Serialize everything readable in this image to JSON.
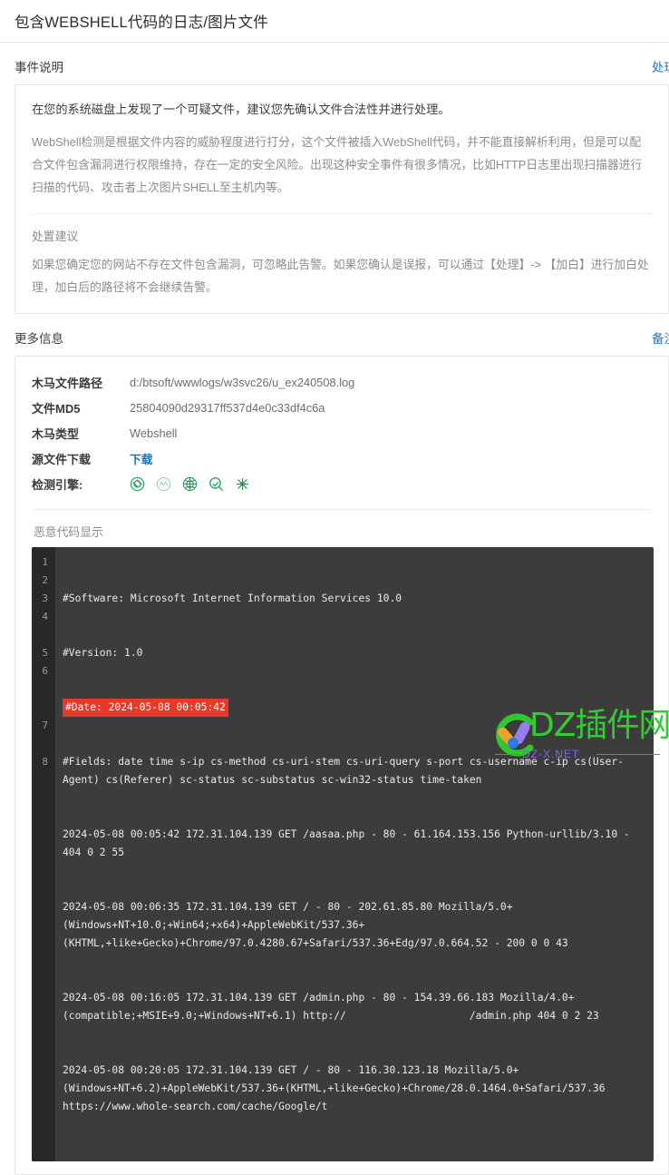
{
  "header": {
    "title": "包含WEBSHELL代码的日志/图片文件"
  },
  "event_section": {
    "title": "事件说明",
    "action_label": "处理",
    "lead": "在您的系统磁盘上发现了一个可疑文件，建议您先确认文件合法性并进行处理。",
    "body": "WebShell检测是根据文件内容的威胁程度进行打分，这个文件被插入WebShell代码，并不能直接解析利用，但是可以配合文件包含漏洞进行权限维持，存在一定的安全风险。出现这种安全事件有很多情况，比如HTTP日志里出现扫描器进行扫描的代码、攻击者上次图片SHELL至主机内等。",
    "advice_title": "处置建议",
    "advice_body": "如果您确定您的网站不存在文件包含漏洞，可忽略此告警。如果您确认是误报，可以通过【处理】-> 【加白】进行加白处理，加白后的路径将不会继续告警。"
  },
  "more_info_section": {
    "title": "更多信息",
    "action_label": "备注",
    "rows": [
      {
        "label": "木马文件路径",
        "value": "d:/btsoft/wwwlogs/w3svc26/u_ex240508.log",
        "type": "text"
      },
      {
        "label": "文件MD5",
        "value": "25804090d29317ff537d4e0c33df4c6a",
        "type": "text"
      },
      {
        "label": "木马类型",
        "value": "Webshell",
        "type": "text"
      },
      {
        "label": "源文件下载",
        "value": "下载",
        "type": "link"
      },
      {
        "label": "检测引擎:",
        "value": "",
        "type": "engines"
      }
    ],
    "engines": [
      "engine-swirl-icon",
      "engine-wave-icon",
      "engine-globe-icon",
      "engine-magnifier-icon",
      "engine-molecule-icon"
    ],
    "engine_color": "#1f9c5a"
  },
  "code_section": {
    "title": "恶意代码显示",
    "highlight_color": "#e8382a",
    "lines": [
      {
        "num": "1",
        "text": "#Software: Microsoft Internet Information Services 10.0",
        "highlight": false
      },
      {
        "num": "2",
        "text": "#Version: 1.0",
        "highlight": false
      },
      {
        "num": "3",
        "text": "#Date: 2024-05-08 00:05:42",
        "highlight": true
      },
      {
        "num": "4",
        "text": "#Fields: date time s-ip cs-method cs-uri-stem cs-uri-query s-port cs-username c-ip cs(User-Agent) cs(Referer) sc-status sc-substatus sc-win32-status time-taken",
        "highlight": false
      },
      {
        "num": "5",
        "text": "2024-05-08 00:05:42 172.31.104.139 GET /aasaa.php - 80 - 61.164.153.156 Python-urllib/3.10 - 404 0 2 55",
        "highlight": false
      },
      {
        "num": "6",
        "text": "2024-05-08 00:06:35 172.31.104.139 GET / - 80 - 202.61.85.80 Mozilla/5.0+(Windows+NT+10.0;+Win64;+x64)+AppleWebKit/537.36+(KHTML,+like+Gecko)+Chrome/97.0.4280.67+Safari/537.36+Edg/97.0.664.52 - 200 0 0 43",
        "highlight": false
      },
      {
        "num": "7",
        "text": "2024-05-08 00:16:05 172.31.104.139 GET /admin.php - 80 - 154.39.66.183 Mozilla/4.0+(compatible;+MSIE+9.0;+Windows+NT+6.1) http://                    /admin.php 404 0 2 23",
        "highlight": false
      },
      {
        "num": "8",
        "text": "2024-05-08 00:20:05 172.31.104.139 GET / - 80 - 116.30.123.18 Mozilla/5.0+(Windows+NT+6.2)+AppleWebKit/537.36+(KHTML,+like+Gecko)+Chrome/28.0.1464.0+Safari/537.36 https://www.whole-search.com/cache/Google/t                  ",
        "highlight": false
      }
    ]
  },
  "watermark": {
    "brand": "DZ插件网",
    "url": "DZ-X.NET",
    "brand_color": "#33cc33",
    "url_color": "#8b5cf6"
  }
}
